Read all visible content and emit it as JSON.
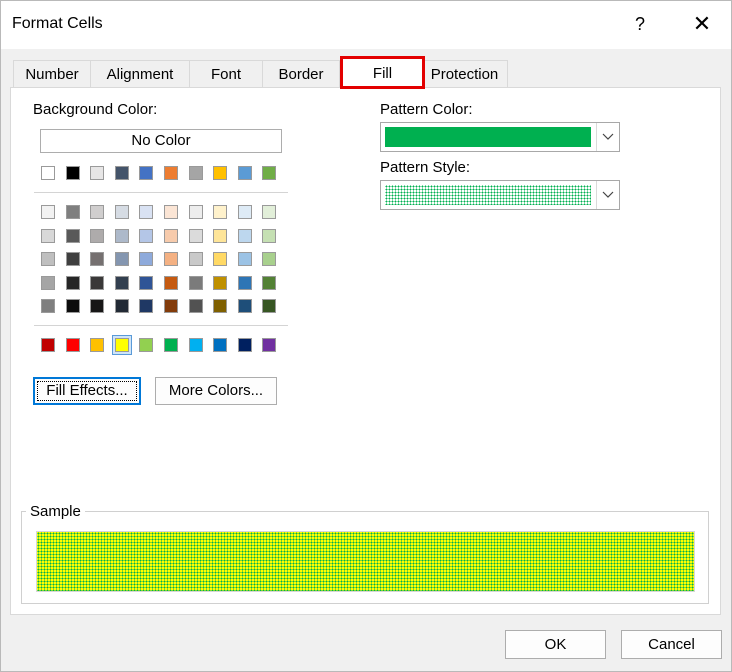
{
  "dialog": {
    "title": "Format Cells",
    "help_label": "?",
    "close_label": "✕"
  },
  "tabs": [
    {
      "label": "Number",
      "active": false
    },
    {
      "label": "Alignment",
      "active": false
    },
    {
      "label": "Font",
      "active": false
    },
    {
      "label": "Border",
      "active": false
    },
    {
      "label": "Fill",
      "active": true
    },
    {
      "label": "Protection",
      "active": false
    }
  ],
  "fill": {
    "background_color_label": "Background Color:",
    "no_color_label": "No Color",
    "theme_top_row": [
      "#ffffff",
      "#000000",
      "#e7e6e6",
      "#44546a",
      "#4472c4",
      "#ed7d31",
      "#a5a5a5",
      "#ffc000",
      "#5b9bd5",
      "#70ad47"
    ],
    "theme_shades": [
      [
        "#f2f2f2",
        "#7f7f7f",
        "#d0cece",
        "#d6dce4",
        "#d9e2f3",
        "#fbe5d5",
        "#ededed",
        "#fff2cc",
        "#deebf6",
        "#e2efd9"
      ],
      [
        "#d8d8d8",
        "#595959",
        "#aeabab",
        "#adb9ca",
        "#b4c6e7",
        "#f7cbac",
        "#dbdbdb",
        "#fee599",
        "#bdd7ee",
        "#c5e0b3"
      ],
      [
        "#bfbfbf",
        "#3f3f3f",
        "#757070",
        "#8496b0",
        "#8eaadb",
        "#f4b183",
        "#c9c9c9",
        "#ffd965",
        "#9cc3e5",
        "#a8d08d"
      ],
      [
        "#a5a5a5",
        "#262626",
        "#3a3838",
        "#323f4f",
        "#2f5496",
        "#c55a11",
        "#7b7b7b",
        "#bf9000",
        "#2e75b5",
        "#538135"
      ],
      [
        "#7f7f7f",
        "#0c0c0c",
        "#171616",
        "#222a35",
        "#1f3864",
        "#833c0b",
        "#525252",
        "#7f6000",
        "#1e4e79",
        "#375623"
      ]
    ],
    "standard_colors": [
      "#c00000",
      "#ff0000",
      "#ffc000",
      "#ffff00",
      "#92d050",
      "#00b050",
      "#00b0f0",
      "#0070c0",
      "#002060",
      "#7030a0"
    ],
    "selected_standard_index": 3,
    "fill_effects_label": "Fill Effects...",
    "more_colors_label": "More Colors...",
    "pattern_color_label": "Pattern Color:",
    "pattern_color_value": "#00b050",
    "pattern_style_label": "Pattern Style:",
    "pattern_style_value": "12.5% Gray (dotted)",
    "sample_label": "Sample",
    "sample_background": "#ffff00",
    "sample_pattern_color": "#00b050"
  },
  "footer": {
    "ok_label": "OK",
    "cancel_label": "Cancel"
  }
}
